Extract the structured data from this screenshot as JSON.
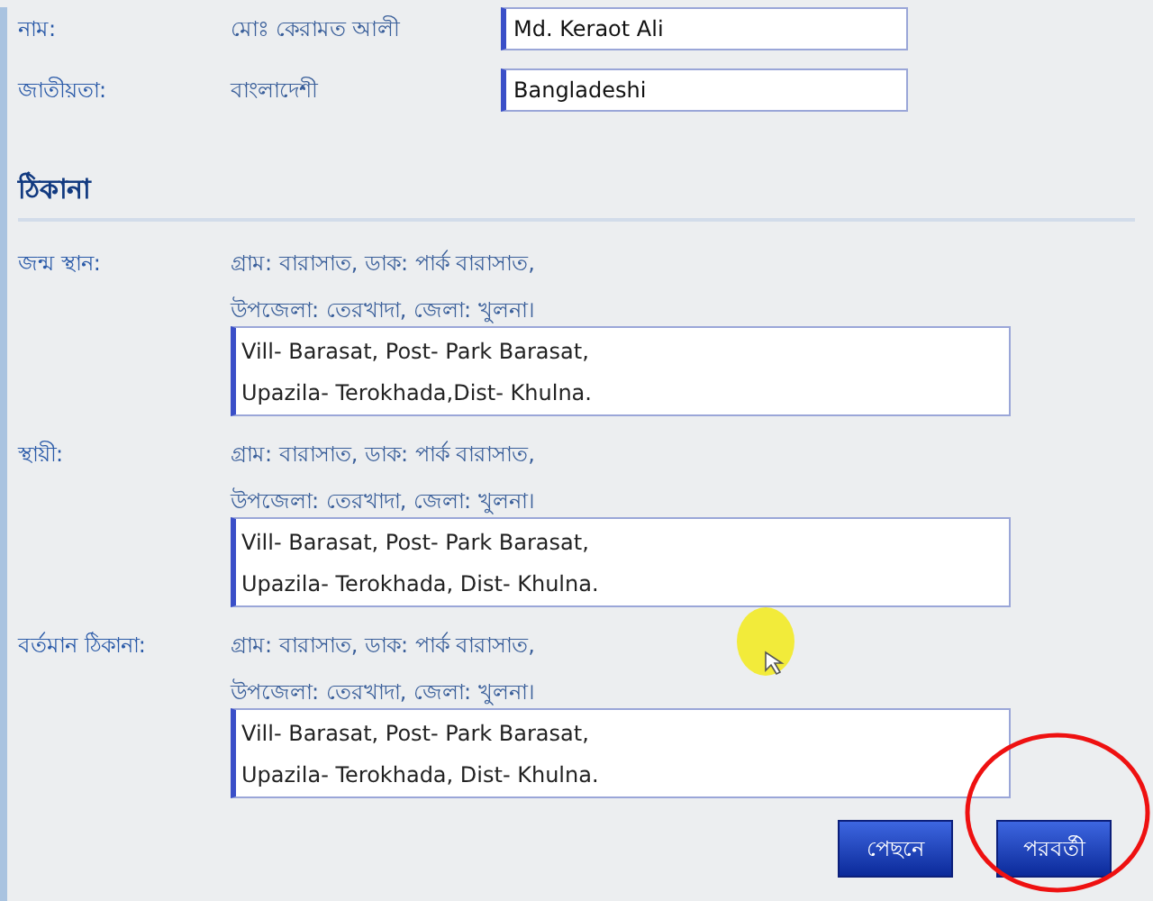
{
  "personal": [
    {
      "label": "নাম:",
      "value_bn": "মোঃ কেরামত আলী",
      "value": "Md. Keraot Ali"
    },
    {
      "label": "জাতীয়তা:",
      "value_bn": "বাংলাদেশী",
      "value": "Bangladeshi"
    }
  ],
  "address": {
    "heading": "ঠিকানা",
    "entries": [
      {
        "label": "জন্ম স্থান:",
        "lines_bn": [
          "গ্রাম: বারাসাত, ডাক: পার্ক বারাসাত,",
          "উপজেলা: তেরখাদা, জেলা: খুলনা।"
        ],
        "value_lines": [
          "Vill- Barasat, Post- Park Barasat,",
          "Upazila- Terokhada,Dist- Khulna."
        ]
      },
      {
        "label": "স্থায়ী:",
        "lines_bn": [
          "গ্রাম: বারাসাত, ডাক: পার্ক বারাসাত,",
          "উপজেলা: তেরখাদা, জেলা: খুলনা।"
        ],
        "value_lines": [
          "Vill- Barasat, Post- Park Barasat,",
          "Upazila- Terokhada, Dist- Khulna."
        ]
      },
      {
        "label": "বর্তমান ঠিকানা:",
        "lines_bn": [
          "গ্রাম: বারাসাত, ডাক: পার্ক বারাসাত,",
          "উপজেলা: তেরখাদা, জেলা: খুলনা।"
        ],
        "value_lines": [
          "Vill- Barasat, Post- Park Barasat,",
          "Upazila- Terokhada, Dist- Khulna."
        ]
      }
    ]
  },
  "buttons": [
    {
      "label": "পেছনে"
    },
    {
      "label": "পরবর্তী"
    }
  ]
}
